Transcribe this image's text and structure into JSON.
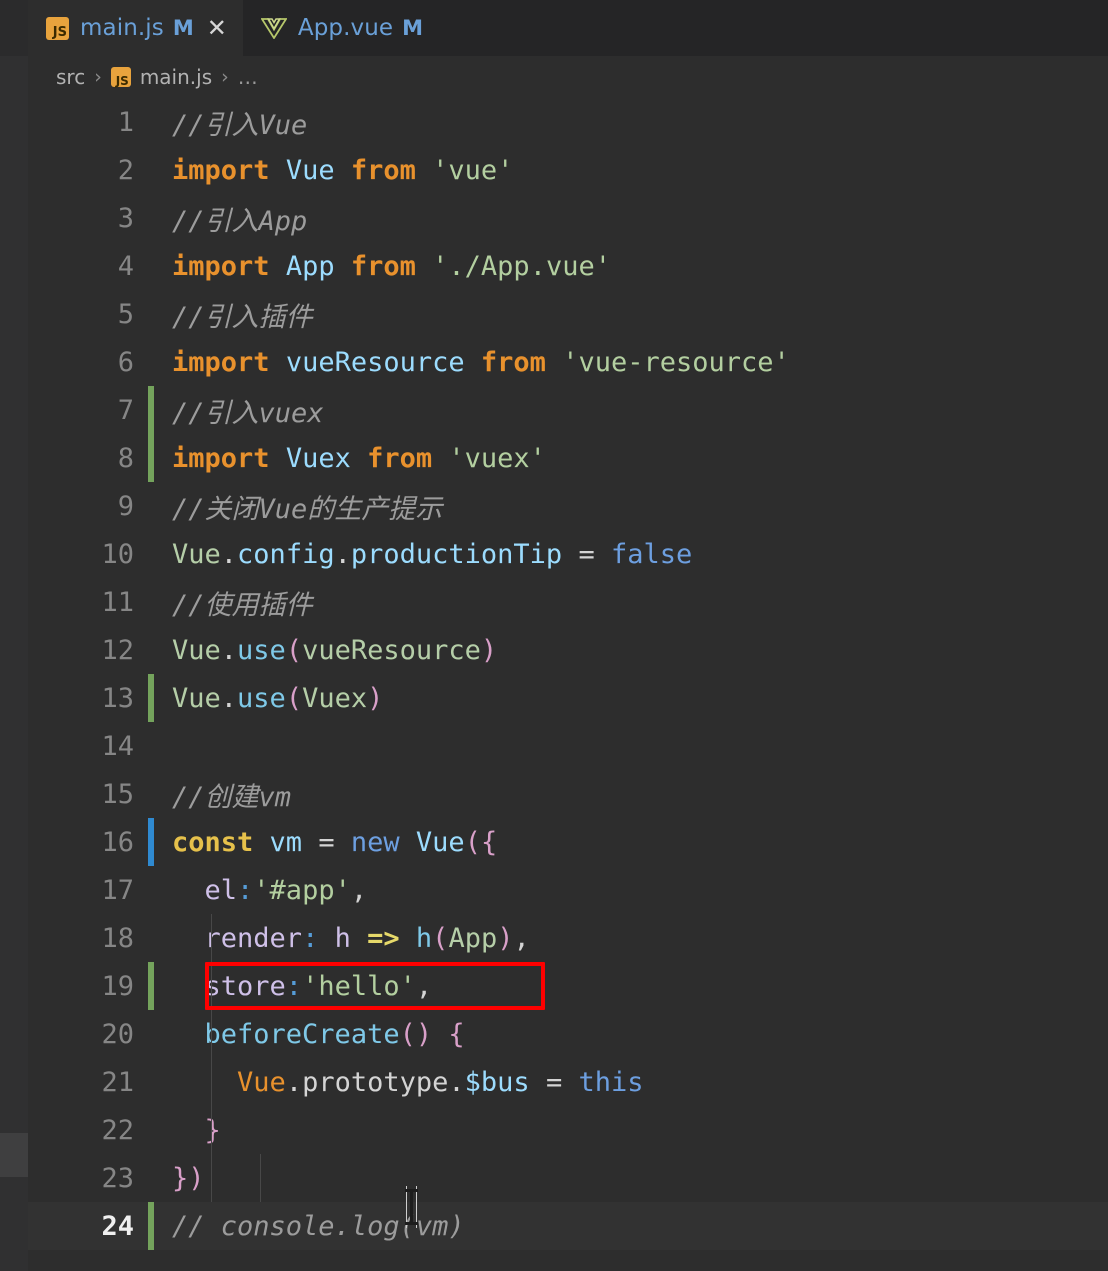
{
  "window": {
    "theme_background": "#2d2d2d",
    "accent_modified": "#6aa0d8"
  },
  "tabs": [
    {
      "label": "main.js",
      "icon": "js-file-icon",
      "dirty_badge": "M",
      "active": true,
      "close_glyph": "✕"
    },
    {
      "label": "App.vue",
      "icon": "vue-file-icon",
      "dirty_badge": "M",
      "active": false
    }
  ],
  "breadcrumb": {
    "folder": "src",
    "separator": "›",
    "file": "main.js",
    "more": "…"
  },
  "editor": {
    "active_line": 24,
    "lines": [
      {
        "n": "1",
        "gutter": "",
        "tokens": [
          {
            "t": "comment",
            "v": "//引入Vue"
          }
        ]
      },
      {
        "n": "2",
        "gutter": "",
        "tokens": [
          {
            "t": "keyword",
            "v": "import"
          },
          {
            "t": "plain",
            "v": " "
          },
          {
            "t": "ident",
            "v": "Vue"
          },
          {
            "t": "plain",
            "v": " "
          },
          {
            "t": "keyword",
            "v": "from"
          },
          {
            "t": "plain",
            "v": " "
          },
          {
            "t": "string",
            "v": "'vue'"
          }
        ]
      },
      {
        "n": "3",
        "gutter": "",
        "tokens": [
          {
            "t": "comment",
            "v": "//引入App"
          }
        ]
      },
      {
        "n": "4",
        "gutter": "",
        "tokens": [
          {
            "t": "keyword",
            "v": "import"
          },
          {
            "t": "plain",
            "v": " "
          },
          {
            "t": "ident",
            "v": "App"
          },
          {
            "t": "plain",
            "v": " "
          },
          {
            "t": "keyword",
            "v": "from"
          },
          {
            "t": "plain",
            "v": " "
          },
          {
            "t": "string",
            "v": "'./App.vue'"
          }
        ]
      },
      {
        "n": "5",
        "gutter": "",
        "tokens": [
          {
            "t": "comment",
            "v": "//引入插件"
          }
        ]
      },
      {
        "n": "6",
        "gutter": "",
        "tokens": [
          {
            "t": "keyword",
            "v": "import"
          },
          {
            "t": "plain",
            "v": " "
          },
          {
            "t": "ident",
            "v": "vueResource"
          },
          {
            "t": "plain",
            "v": " "
          },
          {
            "t": "keyword",
            "v": "from"
          },
          {
            "t": "plain",
            "v": " "
          },
          {
            "t": "string",
            "v": "'vue-resource'"
          }
        ]
      },
      {
        "n": "7",
        "gutter": "added",
        "tokens": [
          {
            "t": "comment",
            "v": "//引入vuex"
          }
        ]
      },
      {
        "n": "8",
        "gutter": "added",
        "tokens": [
          {
            "t": "keyword",
            "v": "import"
          },
          {
            "t": "plain",
            "v": " "
          },
          {
            "t": "ident",
            "v": "Vuex"
          },
          {
            "t": "plain",
            "v": " "
          },
          {
            "t": "keyword",
            "v": "from"
          },
          {
            "t": "plain",
            "v": " "
          },
          {
            "t": "string",
            "v": "'vuex'"
          }
        ]
      },
      {
        "n": "9",
        "gutter": "",
        "tokens": [
          {
            "t": "comment",
            "v": "//关闭Vue的生产提示"
          }
        ]
      },
      {
        "n": "10",
        "gutter": "",
        "tokens": [
          {
            "t": "green",
            "v": "Vue"
          },
          {
            "t": "plain",
            "v": "."
          },
          {
            "t": "ident",
            "v": "config"
          },
          {
            "t": "plain",
            "v": "."
          },
          {
            "t": "ident",
            "v": "productionTip"
          },
          {
            "t": "plain",
            "v": " "
          },
          {
            "t": "op",
            "v": "="
          },
          {
            "t": "plain",
            "v": " "
          },
          {
            "t": "lit",
            "v": "false"
          }
        ]
      },
      {
        "n": "11",
        "gutter": "",
        "tokens": [
          {
            "t": "comment",
            "v": "//使用插件"
          }
        ]
      },
      {
        "n": "12",
        "gutter": "",
        "tokens": [
          {
            "t": "green",
            "v": "Vue"
          },
          {
            "t": "plain",
            "v": "."
          },
          {
            "t": "func",
            "v": "use"
          },
          {
            "t": "paren",
            "v": "("
          },
          {
            "t": "green",
            "v": "vueResource"
          },
          {
            "t": "paren",
            "v": ")"
          }
        ]
      },
      {
        "n": "13",
        "gutter": "added",
        "tokens": [
          {
            "t": "green",
            "v": "Vue"
          },
          {
            "t": "plain",
            "v": "."
          },
          {
            "t": "func",
            "v": "use"
          },
          {
            "t": "paren",
            "v": "("
          },
          {
            "t": "green",
            "v": "Vuex"
          },
          {
            "t": "paren",
            "v": ")"
          }
        ]
      },
      {
        "n": "14",
        "gutter": "",
        "tokens": [
          {
            "t": "plain",
            "v": ""
          }
        ]
      },
      {
        "n": "15",
        "gutter": "",
        "tokens": [
          {
            "t": "comment",
            "v": "//创建vm"
          }
        ]
      },
      {
        "n": "16",
        "gutter": "modified",
        "tokens": [
          {
            "t": "const",
            "v": "const"
          },
          {
            "t": "plain",
            "v": " "
          },
          {
            "t": "ident",
            "v": "vm"
          },
          {
            "t": "plain",
            "v": " "
          },
          {
            "t": "op",
            "v": "="
          },
          {
            "t": "plain",
            "v": " "
          },
          {
            "t": "lit",
            "v": "new"
          },
          {
            "t": "plain",
            "v": " "
          },
          {
            "t": "ident",
            "v": "Vue"
          },
          {
            "t": "paren",
            "v": "({"
          }
        ]
      },
      {
        "n": "17",
        "gutter": "",
        "tokens": [
          {
            "t": "plain",
            "v": "  "
          },
          {
            "t": "prop",
            "v": "el"
          },
          {
            "t": "blue",
            "v": ":"
          },
          {
            "t": "string",
            "v": "'#app'"
          },
          {
            "t": "plain",
            "v": ","
          }
        ]
      },
      {
        "n": "18",
        "gutter": "",
        "tokens": [
          {
            "t": "plain",
            "v": "  "
          },
          {
            "t": "prop",
            "v": "render"
          },
          {
            "t": "blue",
            "v": ":"
          },
          {
            "t": "plain",
            "v": " "
          },
          {
            "t": "prop",
            "v": "h"
          },
          {
            "t": "plain",
            "v": " "
          },
          {
            "t": "arrow",
            "v": "=>"
          },
          {
            "t": "plain",
            "v": " "
          },
          {
            "t": "func",
            "v": "h"
          },
          {
            "t": "paren",
            "v": "("
          },
          {
            "t": "green",
            "v": "App"
          },
          {
            "t": "paren",
            "v": ")"
          },
          {
            "t": "plain",
            "v": ","
          }
        ]
      },
      {
        "n": "19",
        "gutter": "added",
        "tokens": [
          {
            "t": "plain",
            "v": "  "
          },
          {
            "t": "prop",
            "v": "store"
          },
          {
            "t": "blue",
            "v": ":"
          },
          {
            "t": "string",
            "v": "'hello'"
          },
          {
            "t": "plain",
            "v": ","
          }
        ]
      },
      {
        "n": "20",
        "gutter": "",
        "tokens": [
          {
            "t": "plain",
            "v": "  "
          },
          {
            "t": "func",
            "v": "beforeCreate"
          },
          {
            "t": "paren",
            "v": "()"
          },
          {
            "t": "plain",
            "v": " "
          },
          {
            "t": "paren",
            "v": "{"
          }
        ]
      },
      {
        "n": "21",
        "gutter": "",
        "tokens": [
          {
            "t": "plain",
            "v": "    "
          },
          {
            "t": "orange",
            "v": "Vue"
          },
          {
            "t": "plain",
            "v": "."
          },
          {
            "t": "plain",
            "v": "prototype"
          },
          {
            "t": "plain",
            "v": "."
          },
          {
            "t": "ident",
            "v": "$bus"
          },
          {
            "t": "plain",
            "v": " "
          },
          {
            "t": "op",
            "v": "="
          },
          {
            "t": "plain",
            "v": " "
          },
          {
            "t": "lit",
            "v": "this"
          }
        ]
      },
      {
        "n": "22",
        "gutter": "",
        "tokens": [
          {
            "t": "plain",
            "v": "  "
          },
          {
            "t": "paren",
            "v": "}"
          }
        ]
      },
      {
        "n": "23",
        "gutter": "",
        "tokens": [
          {
            "t": "paren",
            "v": "})"
          }
        ]
      },
      {
        "n": "24",
        "gutter": "added",
        "tokens": [
          {
            "t": "comment",
            "v": "// console.log(vm)"
          }
        ]
      }
    ]
  },
  "annotation": {
    "shape": "rectangle",
    "color": "#fe0000",
    "target_line": "19",
    "target_text": "store:'hello',"
  },
  "cursor": {
    "type": "text-ibeam",
    "line": "24"
  }
}
